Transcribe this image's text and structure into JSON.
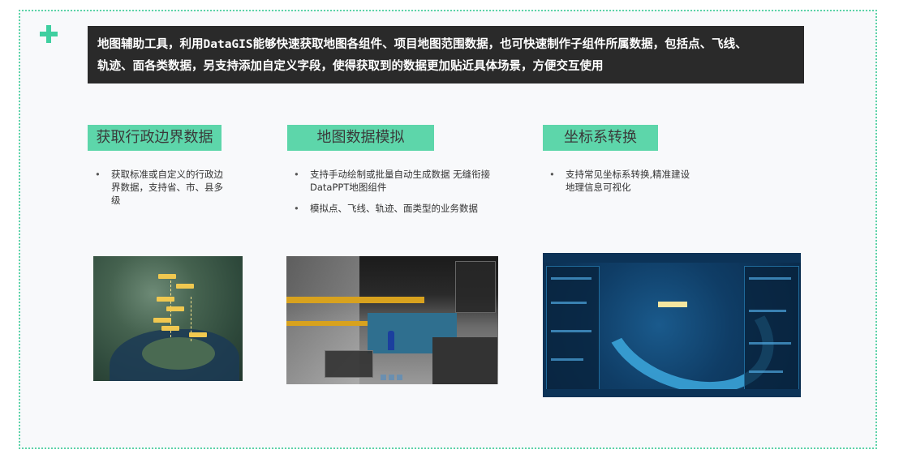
{
  "intro": {
    "line1": "地图辅助工具，利用DataGIS能够快速获取地图各组件、项目地图范围数据，也可快速制作子组件所属数据，包括点、飞线、",
    "line2": "轨迹、面各类数据，另支持添加自定义字段，使得获取到的数据更加贴近具体场景，方便交互使用"
  },
  "columns": [
    {
      "title": "获取行政边界数据",
      "bullets": [
        "获取标准或自定义的行政边界数据，支持省、市、县多级"
      ]
    },
    {
      "title": "地图数据模拟",
      "bullets": [
        "支持手动绘制或批量自动生成数据 无缝衔接DataPPT地图组件",
        "模拟点、飞线、轨迹、面类型的业务数据"
      ]
    },
    {
      "title": "坐标系转换",
      "bullets": [
        "支持常见坐标系转换,精准建设地理信息可视化"
      ]
    }
  ],
  "icons": {
    "corner": "plus-icon",
    "bullet": "bullet-dot-icon"
  },
  "colors": {
    "accent": "#5dd6aa",
    "intro_bg": "#2a2a2a",
    "frame_border": "#5cd3a8"
  }
}
